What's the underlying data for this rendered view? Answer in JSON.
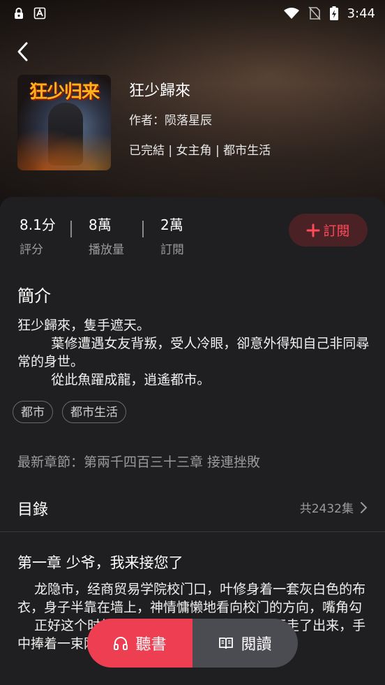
{
  "status_bar": {
    "time": "3:44",
    "left_icons": [
      "lock-icon",
      "font-a-icon"
    ],
    "right_icons": [
      "wifi-icon",
      "no-sim-icon",
      "battery-charging-icon"
    ]
  },
  "book": {
    "cover_text": "狂少归来",
    "title": "狂少歸來",
    "author": "作者：陨落星辰",
    "tags_line": "已完結 | 女主角 | 都市生活"
  },
  "stats": [
    {
      "value": "8.1分",
      "label": "評分"
    },
    {
      "value": "8萬",
      "label": "播放量"
    },
    {
      "value": "2萬",
      "label": "訂閱"
    }
  ],
  "subscribe_label": "訂閱",
  "intro": {
    "heading": "簡介",
    "text": "狂少歸來，隻手遮天。\n        葉修遭遇女友背叛，受人冷眼，卻意外得知自己非同尋常的身世。\n        從此魚躍成龍，逍遙都市。"
  },
  "chips": [
    "都市",
    "都市生活"
  ],
  "latest_chapter": "最新章節：第兩千四百三十三章 接連挫敗",
  "toc": {
    "heading": "目錄",
    "count": "共2432集"
  },
  "chapter": {
    "title": "第一章 少爷，我来接您了",
    "text": "    龙隐市，经商贸易学院校门口，叶修身着一套灰白色的布衣，身子半靠在墙上，神情慵懒地看向校门的方向，嘴角勾\n    正好这个时候，一个穿着时尚的女孩自里面走了出来，手中捧着一束刚刚采来的鲜花，大步走了上去。"
  },
  "actions": {
    "listen": "聽書",
    "read": "閱讀"
  },
  "colors": {
    "accent": "#ee3f52",
    "subscribe_bg": "#4a2226",
    "panel_bg": "#1f1f21"
  }
}
